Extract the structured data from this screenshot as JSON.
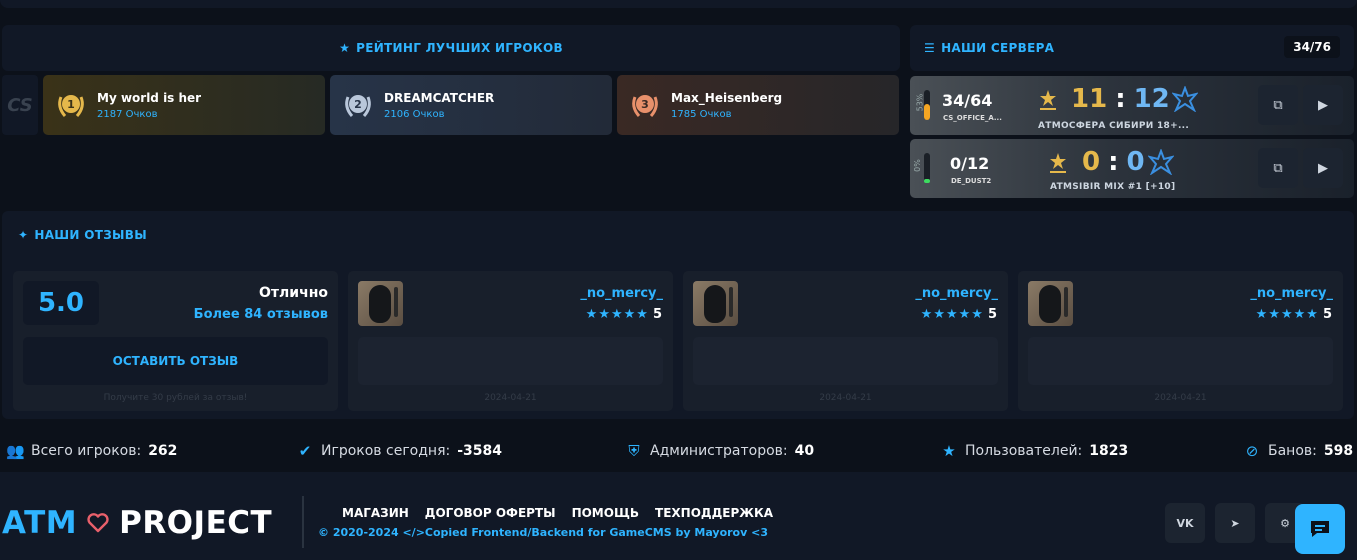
{
  "ranking": {
    "title": "РЕЙТИНГ ЛУЧШИХ ИГРОКОВ",
    "badge": "CS",
    "players": [
      {
        "place": "1",
        "name": "My world is her",
        "score": "2187 Очков",
        "color": "#e5b84b"
      },
      {
        "place": "2",
        "name": "DREAMCATCHER",
        "score": "2106 Очков",
        "color": "#b9c7da"
      },
      {
        "place": "3",
        "name": "Max_Heisenberg",
        "score": "1785 Очков",
        "color": "#e8906b"
      }
    ]
  },
  "servers": {
    "title": "НАШИ СЕРВЕРА",
    "count": "34/76",
    "list": [
      {
        "percent": "53%",
        "fill": 0.53,
        "fill_color": "#f5a623",
        "online": "34/64",
        "map": "CS_OFFICE_A...",
        "score_t": "11",
        "sep": ":",
        "score_ct": "12",
        "name": "АТМОСФЕРА СИБИРИ 18+..."
      },
      {
        "percent": "0%",
        "fill": 0.0,
        "fill_color": "#3ddc60",
        "online": "0/12",
        "map": "DE_DUST2",
        "score_t": "0",
        "sep": ":",
        "score_ct": "0",
        "name": "ATMSIBIR MIX #1 [+10]"
      }
    ]
  },
  "reviews": {
    "title": "НАШИ ОТЗЫВЫ",
    "summary": {
      "rating": "5.0",
      "word": "Отлично",
      "more_prefix": "Более",
      "more_count": "84",
      "more_suffix": "отзывов",
      "button": "ОСТАВИТЬ ОТЗЫВ",
      "hint": "Получите 30 рублей за отзыв!"
    },
    "items": [
      {
        "name": "_no_mercy_",
        "stars": "★★★★★",
        "score": "5",
        "date": "2024-04-21"
      },
      {
        "name": "_no_mercy_",
        "stars": "★★★★★",
        "score": "5",
        "date": "2024-04-21"
      },
      {
        "name": "_no_mercy_",
        "stars": "★★★★★",
        "score": "5",
        "date": "2024-04-21"
      }
    ]
  },
  "stats": [
    {
      "icon": "users-icon",
      "label": "Всего игроков:",
      "value": "262"
    },
    {
      "icon": "user-check-icon",
      "label": "Игроков сегодня:",
      "value": "-3584"
    },
    {
      "icon": "shield-icon",
      "label": "Администраторов:",
      "value": "40"
    },
    {
      "icon": "star-icon",
      "label": "Пользователей:",
      "value": "1823"
    },
    {
      "icon": "ban-icon",
      "label": "Банов:",
      "value": "598"
    }
  ],
  "footer": {
    "logo_left": "ATM",
    "logo_right": "PROJECT",
    "links": [
      "МАГАЗИН",
      "ДОГОВОР ОФЕРТЫ",
      "ПОМОЩЬ",
      "ТЕХПОДДЕРЖКА"
    ],
    "copyright": "© 2020-2024 </>Copied Frontend/Backend for GameCMS by Mayorov <3",
    "social": {
      "vk": "VK",
      "telegram": "➤",
      "steam": "⚙"
    }
  },
  "colors": {
    "accent": "#2fb4ff",
    "bg": "#0c111a",
    "panel": "#111826"
  }
}
